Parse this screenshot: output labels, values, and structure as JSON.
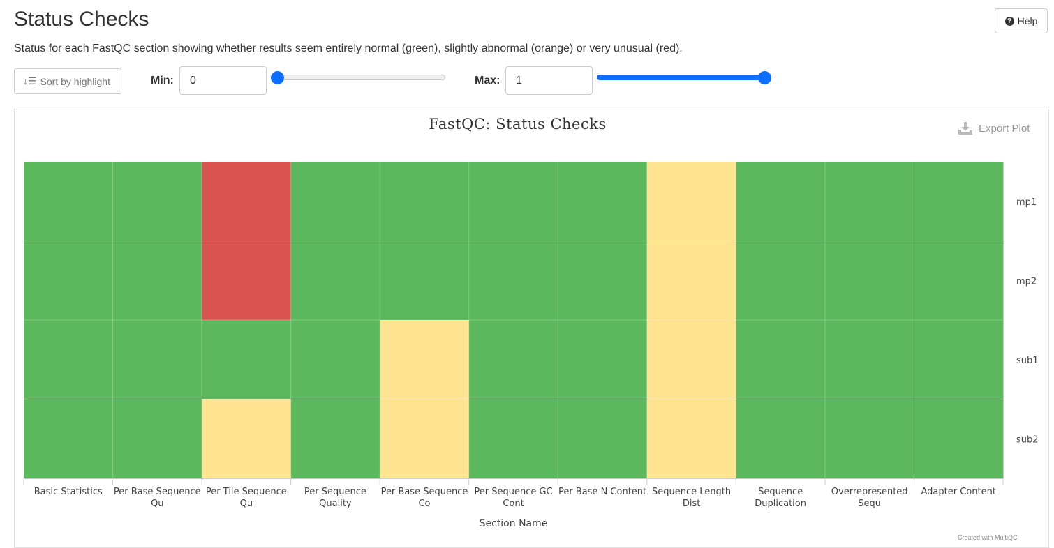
{
  "header": {
    "title": "Status Checks",
    "help_label": "Help",
    "description": "Status for each FastQC section showing whether results seem entirely normal (green), slightly abnormal (orange) or very unusual (red)."
  },
  "controls": {
    "sort_label": "Sort by highlight",
    "min_label": "Min:",
    "min_value": "0",
    "min_slider_level": 0,
    "max_label": "Max:",
    "max_value": "1",
    "max_slider_level": 1
  },
  "plot": {
    "export_label": "Export Plot",
    "footer": "Created with MultiQC"
  },
  "colors": {
    "pass": "#5cb85c",
    "warn": "#fee391",
    "fail": "#d9534f",
    "accent": "#0d6efd"
  },
  "chart_data": {
    "type": "heatmap",
    "title": "FastQC: Status Checks",
    "xlabel": "Section Name",
    "ylabel": "",
    "x_categories": [
      "Basic Statistics",
      "Per Base Sequence Qu",
      "Per Tile Sequence Qu",
      "Per Sequence Quality",
      "Per Base Sequence Co",
      "Per Sequence GC Cont",
      "Per Base N Content",
      "Sequence Length Dist",
      "Sequence Duplication",
      "Overrepresented Sequ",
      "Adapter Content"
    ],
    "y_categories": [
      "mp1",
      "mp2",
      "sub1",
      "sub2"
    ],
    "values": [
      [
        1,
        1,
        0,
        1,
        1,
        1,
        1,
        0.5,
        1,
        1,
        1
      ],
      [
        1,
        1,
        0,
        1,
        1,
        1,
        1,
        0.5,
        1,
        1,
        1
      ],
      [
        1,
        1,
        1,
        1,
        0.5,
        1,
        1,
        0.5,
        1,
        1,
        1
      ],
      [
        1,
        1,
        0.5,
        1,
        0.5,
        1,
        1,
        0.5,
        1,
        1,
        1
      ]
    ],
    "value_legend": {
      "1": "pass",
      "0.5": "warn",
      "0": "fail"
    },
    "grid": true
  }
}
